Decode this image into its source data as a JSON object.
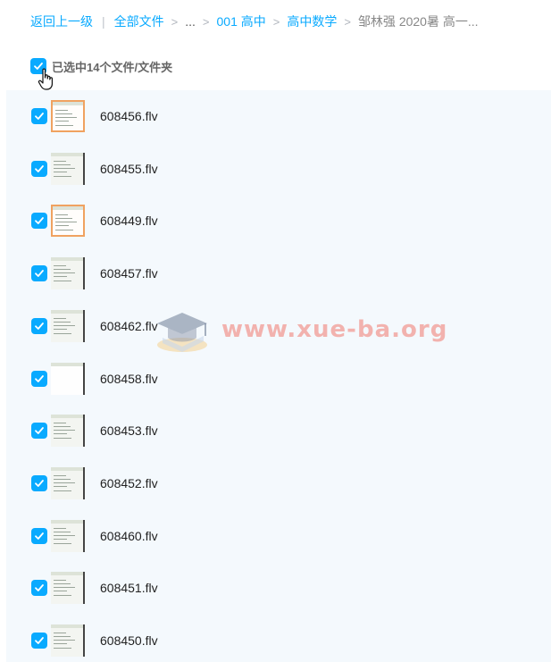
{
  "breadcrumb": {
    "back": "返回上一级",
    "all_files": "全部文件",
    "ellipsis": "...",
    "level1": "001 高中",
    "level2": "高中数学",
    "current": "邹林强 2020暑 高一..."
  },
  "selection": {
    "label": "已选中14个文件/文件夹",
    "checked": true
  },
  "files": [
    {
      "name": "608456.flv",
      "thumb": "orange"
    },
    {
      "name": "608455.flv",
      "thumb": "gray"
    },
    {
      "name": "608449.flv",
      "thumb": "orange"
    },
    {
      "name": "608457.flv",
      "thumb": "gray"
    },
    {
      "name": "608462.flv",
      "thumb": "gray"
    },
    {
      "name": "608458.flv",
      "thumb": "white"
    },
    {
      "name": "608453.flv",
      "thumb": "gray"
    },
    {
      "name": "608452.flv",
      "thumb": "gray"
    },
    {
      "name": "608460.flv",
      "thumb": "gray"
    },
    {
      "name": "608451.flv",
      "thumb": "gray"
    },
    {
      "name": "608450.flv",
      "thumb": "gray"
    }
  ],
  "watermark": {
    "text": "www.xue-ba.org"
  },
  "colors": {
    "accent": "#09aaff",
    "list_bg": "#f4f9fd"
  },
  "icons": {
    "checkbox": "checkmark-icon",
    "cursor": "hand-pointer-icon",
    "breadcrumb_arrow": "chevron-right-icon"
  }
}
